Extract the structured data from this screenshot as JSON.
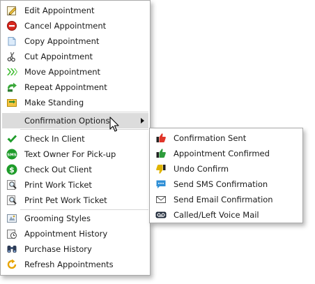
{
  "main_menu": {
    "items": [
      {
        "label": "Edit Appointment",
        "icon": "edit-appointment-icon"
      },
      {
        "label": "Cancel Appointment",
        "icon": "cancel-icon"
      },
      {
        "label": "Copy Appointment",
        "icon": "copy-icon"
      },
      {
        "label": "Cut Appointment",
        "icon": "scissors-icon"
      },
      {
        "label": "Move Appointment",
        "icon": "move-arrows-icon"
      },
      {
        "label": "Repeat Appointment",
        "icon": "repeat-icon"
      },
      {
        "label": "Make Standing",
        "icon": "make-standing-icon"
      },
      {
        "label": "Confirmation Options",
        "icon": "none",
        "highlighted": true,
        "has_submenu": true
      },
      {
        "label": "Check In Client",
        "icon": "checkmark-icon"
      },
      {
        "label": "Text Owner For Pick-up",
        "icon": "sms-icon"
      },
      {
        "label": "Check Out Client",
        "icon": "dollar-icon"
      },
      {
        "label": "Print Work Ticket",
        "icon": "print-magnifier-icon"
      },
      {
        "label": "Print Pet Work Ticket",
        "icon": "print-magnifier-icon"
      },
      {
        "label": "Grooming Styles",
        "icon": "grooming-styles-icon"
      },
      {
        "label": "Appointment History",
        "icon": "history-icon"
      },
      {
        "label": "Purchase History",
        "icon": "binoculars-icon"
      },
      {
        "label": "Refresh Appointments",
        "icon": "refresh-icon"
      }
    ]
  },
  "submenu": {
    "items": [
      {
        "label": "Confirmation Sent",
        "icon": "thumbs-down-red-icon"
      },
      {
        "label": "Appointment Confirmed",
        "icon": "thumbs-up-green-icon"
      },
      {
        "label": "Undo Confirm",
        "icon": "thumbs-down-yellow-icon"
      },
      {
        "label": "Send SMS Confirmation",
        "icon": "chat-bubble-icon"
      },
      {
        "label": "Send Email Confirmation",
        "icon": "envelope-icon"
      },
      {
        "label": "Called/Left Voice Mail",
        "icon": "voicemail-icon"
      }
    ]
  },
  "colors": {
    "highlight": "#dcdcdc",
    "border": "#a9a9a9",
    "cancel_red": "#d9281e",
    "check_green": "#1e9c2a",
    "confirm_green": "#2e9c3c",
    "undo_yellow": "#e0b400",
    "sms_blue": "#2f8fd6"
  }
}
